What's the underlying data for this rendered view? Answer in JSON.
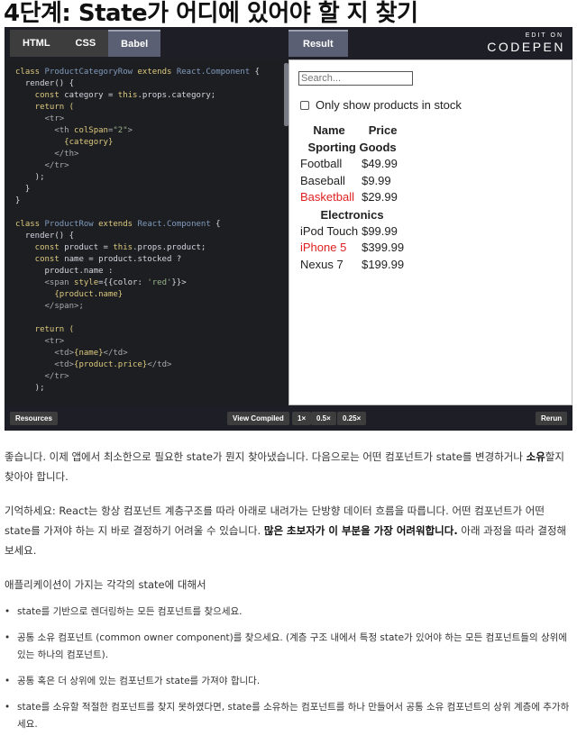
{
  "page_title": "4단계: State가 어디에 있어야 할 지 찾기",
  "codepen": {
    "tabs": [
      "HTML",
      "CSS",
      "Babel"
    ],
    "active_tab": "Babel",
    "result_tab": "Result",
    "brand_edit": "EDIT ON",
    "brand_name": "CODEPEN",
    "bottom": {
      "resources": "Resources",
      "view_compiled": "View Compiled",
      "zoom_1x": "1×",
      "zoom_05x": "0.5×",
      "zoom_025x": "0.25×",
      "rerun": "Rerun"
    }
  },
  "code": {
    "line1_kw1": "class ",
    "line1_cls": "ProductCategoryRow",
    "line1_kw2": " extends ",
    "line1_base": "React.Component",
    "line1_end": " {",
    "line2": "  render() {",
    "line3_kw": "    const ",
    "line3_rest": "category = ",
    "line3_this": "this",
    "line3_end": ".props.category;",
    "line4": "    return (",
    "line5": "      <tr>",
    "line6_a": "        <th ",
    "line6_attr": "colSpan",
    "line6_b": "=",
    "line6_val": "\"2\"",
    "line6_c": ">",
    "line7": "          {category}",
    "line8": "        </th>",
    "line9": "      </tr>",
    "line10": "    );",
    "line11": "  }",
    "line12": "}",
    "line14_kw1": "class ",
    "line14_cls": "ProductRow",
    "line14_kw2": " extends ",
    "line14_base": "React.Component",
    "line14_end": " {",
    "line15": "  render() {",
    "line16_kw": "    const ",
    "line16_rest": "product = ",
    "line16_this": "this",
    "line16_end": ".props.product;",
    "line17_kw": "    const ",
    "line17_rest": "name = product.stocked ?",
    "line18": "      product.name :",
    "line19_a": "      <span ",
    "line19_attr": "style",
    "line19_b": "={{color: ",
    "line19_val": "'red'",
    "line19_c": "}}>",
    "line20": "        {product.name}",
    "line21": "      </span>;",
    "line23": "    return (",
    "line24": "      <tr>",
    "line25_a": "        <td>",
    "line25_b": "{name}",
    "line25_c": "</td>",
    "line26_a": "        <td>",
    "line26_b": "{product.price}",
    "line26_c": "</td>",
    "line27": "      </tr>",
    "line28": "    );"
  },
  "result": {
    "search_placeholder": "Search...",
    "stock_label": "Only show products in stock",
    "headers": [
      "Name",
      "Price"
    ],
    "categories": [
      "Sporting Goods",
      "Electronics"
    ],
    "sporting": [
      {
        "name": "Football",
        "price": "$49.99",
        "in_stock": true
      },
      {
        "name": "Baseball",
        "price": "$9.99",
        "in_stock": true
      },
      {
        "name": "Basketball",
        "price": "$29.99",
        "in_stock": false
      }
    ],
    "electronics": [
      {
        "name": "iPod Touch",
        "price": "$99.99",
        "in_stock": true
      },
      {
        "name": "iPhone 5",
        "price": "$399.99",
        "in_stock": false
      },
      {
        "name": "Nexus 7",
        "price": "$199.99",
        "in_stock": true
      }
    ],
    "out_of_stock_color": "#e02020"
  },
  "article": {
    "p1": "좋습니다. 이제 앱에서 최소한으로 필요한 state가 뭔지 찾아냈습니다. 다음으로는 어떤 컴포넌트가 state를 변경하거나 ",
    "p1_bold": "소유",
    "p1_end": "할지 찾아야 합니다.",
    "p2": "기억하세요: React는 항상 컴포넌트 계층구조를 따라 아래로 내려가는 단방향 데이터 흐름을 따릅니다. 어떤 컴포넌트가 어떤 state를 가져야 하는 지 바로 결정하기 어려울 수 있습니다. ",
    "p2_bold": "많은 초보자가 이 부분을 가장 어려워합니다.",
    "p2_end": " 아래 과정을 따라 결정해 보세요.",
    "p3": "애플리케이션이 가지는 각각의 state에 대해서",
    "bullets": [
      "state를 기반으로 렌더링하는 모든 컴포넌트를 찾으세요.",
      "공통 소유 컴포넌트 (common owner component)를 찾으세요. (계층 구조 내에서 특정 state가 있어야 하는 모든 컴포넌트들의 상위에 있는 하나의 컴포넌트).",
      "공통 혹은 더 상위에 있는 컴포넌트가 state를 가져야 합니다.",
      "state를 소유할 적절한 컴포넌트를 찾지 못하였다면, state를 소유하는 컴포넌트를 하나 만들어서 공통 소유 컴포넌트의 상위 계층에 추가하세요."
    ]
  }
}
